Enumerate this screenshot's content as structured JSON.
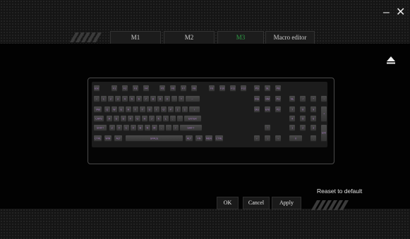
{
  "window": {
    "minimize_glyph": "–",
    "close_glyph": "✕"
  },
  "tabs": [
    {
      "label": "M1",
      "active": false
    },
    {
      "label": "M2",
      "active": false
    },
    {
      "label": "M3",
      "active": true
    },
    {
      "label": "Macro editor",
      "active": false
    }
  ],
  "colors": {
    "accent": "#b884d6",
    "active_tab": "#2f9e46"
  },
  "icons": {
    "eject": "eject-icon"
  },
  "keyboard": {
    "rows": [
      [
        "ESC",
        "F1",
        "F2",
        "F3",
        "F4",
        "F5",
        "F6",
        "F7",
        "F8",
        "F9",
        "F10",
        "F11",
        "F12",
        "PS",
        "SL",
        "PB"
      ],
      [
        "~",
        "1",
        "2",
        "3",
        "4",
        "5",
        "6",
        "7",
        "8",
        "9",
        "0",
        "-",
        "=",
        "←",
        "INS",
        "HM",
        "PU",
        "NL",
        "/",
        "*",
        "-"
      ],
      [
        "TAB",
        "Q",
        "W",
        "E",
        "R",
        "T",
        "Y",
        "U",
        "I",
        "O",
        "P",
        "[",
        "]",
        "\\",
        "DEL",
        "END",
        "PD",
        "7",
        "8",
        "9",
        "+"
      ],
      [
        "CAPS",
        "A",
        "S",
        "D",
        "F",
        "G",
        "H",
        "J",
        "K",
        "L",
        ";",
        "'",
        "ENTER",
        "4",
        "5",
        "6"
      ],
      [
        "SHIFT",
        "Z",
        "X",
        "C",
        "V",
        "B",
        "N",
        "M",
        ",",
        ".",
        "/",
        "SHIFT",
        "↑",
        "1",
        "2",
        "3",
        "ENT"
      ],
      [
        "CTRL",
        "WIN",
        "ALT",
        "SPACE",
        "ALT",
        "FN",
        "MENU",
        "CTRL",
        "←",
        "↓",
        "→",
        "0",
        "."
      ]
    ]
  },
  "actions": {
    "reset_label": "Reaset to default",
    "ok_label": "OK",
    "cancel_label": "Cancel",
    "apply_label": "Apply"
  }
}
